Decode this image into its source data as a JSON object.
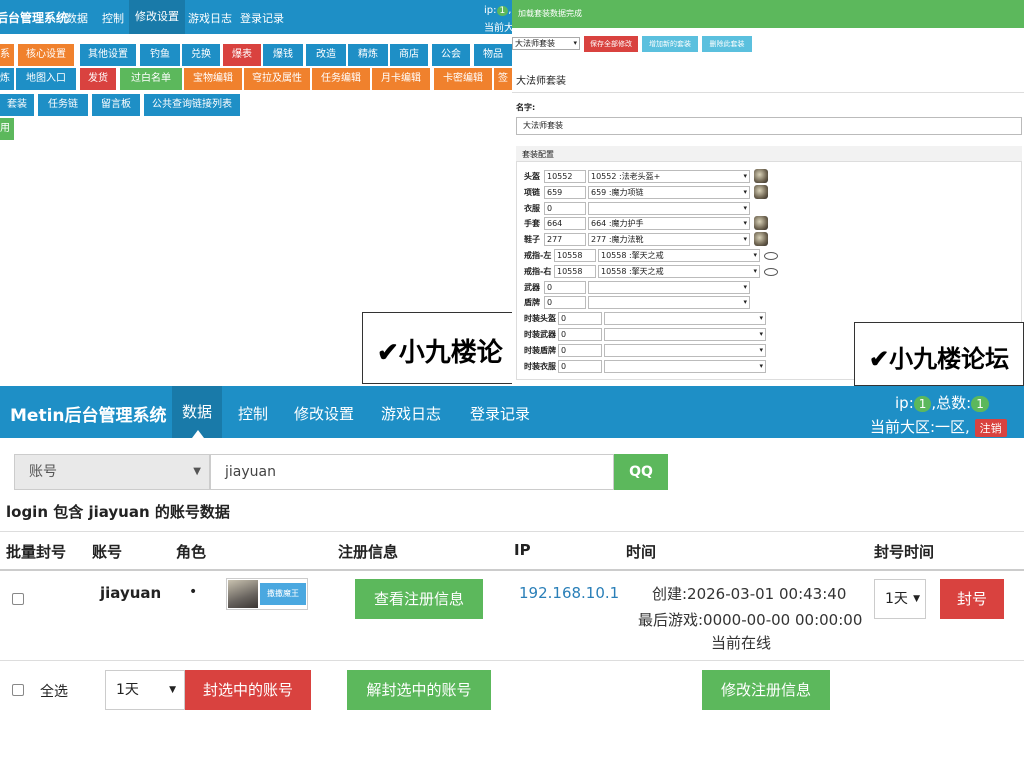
{
  "settings_panel": {
    "brand": "后台管理系统",
    "nav": [
      "数据",
      "控制",
      "修改设置",
      "游戏日志",
      "登录记录"
    ],
    "ip_label": "ip:",
    "ip_count": "1",
    "ip_tail": ",",
    "current_zone": "当前大",
    "menu_row1": [
      "系",
      "核心设置",
      "其他设置",
      "钓鱼",
      "兑换",
      "爆表",
      "爆钱",
      "改造",
      "精炼",
      "商店",
      "公会",
      "物品"
    ],
    "menu_row2": [
      "炼",
      "地图入口",
      "发货",
      "过白名单",
      "宝物编辑",
      "穹拉及属性",
      "任务编辑",
      "月卡编辑",
      "卡密编辑",
      "签"
    ],
    "menu_row3": [
      "套装",
      "任务链",
      "留言板",
      "公共查询链接列表"
    ],
    "menu_row4": [
      "用"
    ],
    "watermark": "✔小九楼论"
  },
  "outfit_panel": {
    "top_message": "加载套装数据完成",
    "preset_select": "大法师套装",
    "buttons": {
      "save_all": "保存全部修改",
      "add_new": "增加新的套装",
      "delete": "删除此套装"
    },
    "section_title": "大法师套装",
    "name_label": "名字:",
    "name_value": "大法师套装",
    "config_title": "套装配置",
    "slots": [
      {
        "label": "头盔",
        "id": "10552",
        "name": "10552 :法老头盔+"
      },
      {
        "label": "项链",
        "id": "659",
        "name": "659 :魔力项链"
      },
      {
        "label": "衣服",
        "id": "0",
        "name": ""
      },
      {
        "label": "手套",
        "id": "664",
        "name": "664 :魔力护手"
      },
      {
        "label": "鞋子",
        "id": "277",
        "name": "277 :魔力法靴"
      },
      {
        "label": "戒指-左",
        "id": "10558",
        "name": "10558 :擎天之戒"
      },
      {
        "label": "戒指-右",
        "id": "10558",
        "name": "10558 :擎天之戒"
      },
      {
        "label": "武器",
        "id": "0",
        "name": ""
      },
      {
        "label": "盾牌",
        "id": "0",
        "name": ""
      },
      {
        "label": "时装头盔",
        "id": "0",
        "name": ""
      },
      {
        "label": "时装武器",
        "id": "0",
        "name": ""
      },
      {
        "label": "时装盾牌",
        "id": "0",
        "name": ""
      },
      {
        "label": "时装衣服",
        "id": "0",
        "name": ""
      }
    ],
    "watermark": "✔小九楼论坛"
  },
  "account_panel": {
    "brand": "Metin后台管理系统",
    "nav": [
      "数据",
      "控制",
      "修改设置",
      "游戏日志",
      "登录记录"
    ],
    "ip_label": "ip:",
    "ip_count": "1",
    "total_label": ",总数:",
    "total_count": "1",
    "current_zone": "当前大区:一区,",
    "logout": "注销",
    "search_field": "账号",
    "search_value": "jiayuan",
    "search_button": "QQ",
    "caption": "login 包含 jiayuan 的账号数据",
    "headers": [
      "批量封号",
      "账号",
      "角色",
      "注册信息",
      "IP",
      "时间",
      "封号时间"
    ],
    "row": {
      "account": "jiayuan",
      "bullet": "•",
      "role_name": "撒撒魔王",
      "view_register": "查看注册信息",
      "ip": "192.168.10.1",
      "created": "创建:2026-03-01 00:43:40",
      "last_game": "最后游戏:0000-00-00 00:00:00",
      "online": "当前在线",
      "ban_duration": "1天",
      "ban_button": "封号"
    },
    "footer": {
      "select_all": "全选",
      "ban_duration": "1天",
      "ban_selected": "封选中的账号",
      "unban_selected": "解封选中的账号",
      "edit_register": "修改注册信息"
    }
  }
}
